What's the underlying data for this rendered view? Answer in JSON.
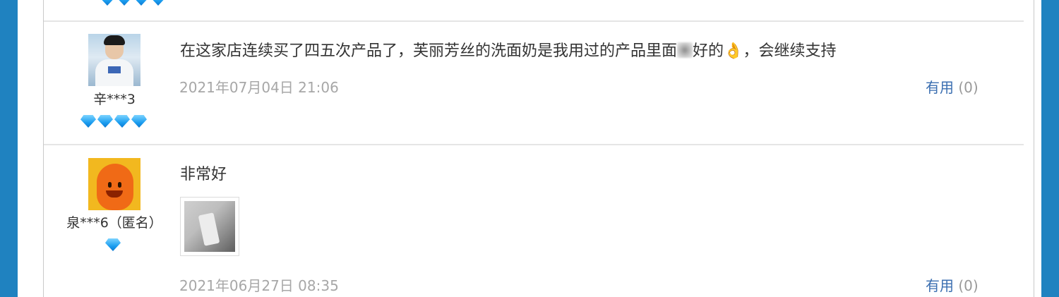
{
  "reviews": [
    {
      "user": "辛***3",
      "level_gems": 4,
      "text_before": "在这家店连续买了四五次产品了，芙丽芳丝的洗面奶是我用过的产品里面",
      "text_after": "好的",
      "emoji": "👌",
      "text_end": "，会继续支持",
      "date": "2021年07月04日 21:06",
      "useful_label": "有用",
      "useful_count": "(0)"
    },
    {
      "user": "泉***6（匿名）",
      "level_gems": 1,
      "text": "非常好",
      "date": "2021年06月27日 08:35",
      "useful_label": "有用",
      "useful_count": "(0)"
    }
  ],
  "colors": {
    "background": "#1f82c0",
    "gem": "#1c9ef0",
    "useful_link": "#3a6eb0",
    "date_text": "#a7a7a7"
  }
}
